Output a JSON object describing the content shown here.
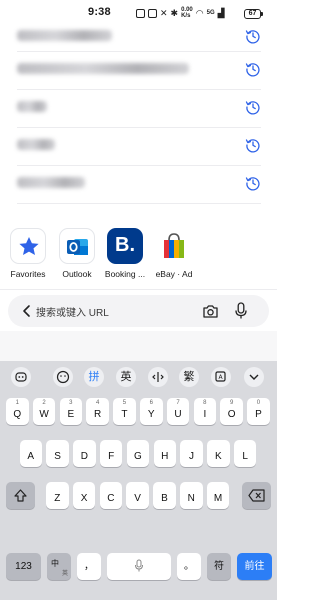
{
  "status_bar": {
    "time": "9:38",
    "network": "5G",
    "speed_top": "0.00",
    "speed_bottom": "K/s",
    "battery": "67"
  },
  "history": {
    "rows": [
      {
        "blur_width": 95
      },
      {
        "blur_width": 172
      },
      {
        "blur_width": 30
      },
      {
        "blur_width": 38
      },
      {
        "blur_width": 68
      }
    ]
  },
  "shortcuts": [
    {
      "label": "Favorites",
      "icon": "star-icon",
      "color": "#2f63e8"
    },
    {
      "label": "Outlook",
      "icon": "outlook-icon",
      "color": "#0a64c8"
    },
    {
      "label": "Booking ...",
      "icon": "booking-icon",
      "color": "#003a8c"
    },
    {
      "label": "eBay · Ad",
      "icon": "ebay-bag-icon",
      "color": "#e53238"
    }
  ],
  "url_bar": {
    "placeholder": "搜索或键入 URL"
  },
  "keyboard": {
    "toolbar": {
      "pinyin": "拼",
      "english": "英",
      "traditional": "繁"
    },
    "row1": [
      {
        "num": "1",
        "ch": "Q"
      },
      {
        "num": "2",
        "ch": "W"
      },
      {
        "num": "3",
        "ch": "E"
      },
      {
        "num": "4",
        "ch": "R"
      },
      {
        "num": "5",
        "ch": "T"
      },
      {
        "num": "6",
        "ch": "Y"
      },
      {
        "num": "7",
        "ch": "U"
      },
      {
        "num": "8",
        "ch": "I"
      },
      {
        "num": "9",
        "ch": "O"
      },
      {
        "num": "0",
        "ch": "P"
      }
    ],
    "row2": [
      "A",
      "S",
      "D",
      "F",
      "G",
      "H",
      "J",
      "K",
      "L"
    ],
    "row3": [
      "Z",
      "X",
      "C",
      "V",
      "B",
      "N",
      "M"
    ],
    "bottom": {
      "num_key": "123",
      "lang_key_top": "中",
      "lang_key_bottom": "英",
      "comma": "，",
      "period": "。",
      "symbol": "符",
      "enter": "前往"
    }
  }
}
